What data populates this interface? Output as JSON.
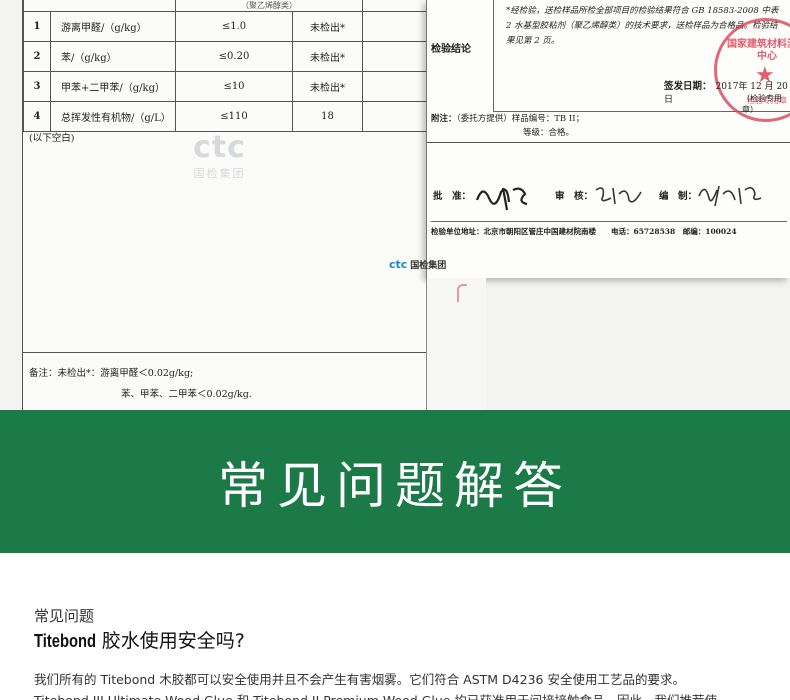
{
  "report": {
    "header_partial": "（聚乙烯醇类）",
    "rows": [
      {
        "no": "1",
        "item": "游离甲醛/（g/kg）",
        "limit": "≤1.0",
        "result": "未检出*"
      },
      {
        "no": "2",
        "item": "苯/（g/kg）",
        "limit": "≤0.20",
        "result": "未检出*"
      },
      {
        "no": "3",
        "item": "甲苯+二甲苯/（g/kg）",
        "limit": "≤10",
        "result": "未检出*"
      },
      {
        "no": "4",
        "item": "总挥发性有机物/（g/L）",
        "limit": "≤110",
        "result": "18"
      }
    ],
    "blank_note": "(以下空白)",
    "watermark_logo": "ctc",
    "watermark_name": "国检集团",
    "remark_line1": "备注：未检出*：游离甲醛＜0.02g/kg;",
    "remark_line2": "苯、甲苯、二甲苯＜0.02g/kg.",
    "conclusion_label": "检验结论",
    "conclusion_text": "*经检验，送检样品所检全部项目的检验结果符合 GB 18583-2008 中表 2 水基型胶粘剂（聚乙烯醇类）的技术要求，送检样品为合格品。检验结果见第 2 页。",
    "sign_date_label": "签发日期：",
    "sign_date": "2017年 12 月 20 日",
    "seal_note": "（检验专用章）",
    "stamp_text": "国家建筑材料测试中心",
    "stamp_sub": "检验专用章",
    "attach_label": "附注：",
    "attach_line1": "（委托方提供）样品编号：TB II；",
    "attach_line2": "等级：合格。",
    "approve_label": "批　准：",
    "review_label": "审　核：",
    "compile_label": "编　制：",
    "address": "检验单位地址：北京市朝阳区管庄中国建材院南楼　　电话：65728538　邮编：100024",
    "footer_logo": "ctc",
    "footer_name": "国检集团"
  },
  "banner": {
    "title": "常见问题解答"
  },
  "faq": {
    "subtitle": "常见问题",
    "brand": "Titebond",
    "question": " 胶水使用安全吗?",
    "answer_line1": "我们所有的 Titebond 木胶都可以安全使用并且不会产生有害烟雾。它们符合 ASTM D4236 安全使用工艺品的要求。",
    "answer_line2": "Titebond III Ultimate Wood Glue 和 Titebond II Premium Wood Glue 均已获准用于间接接触食品，因此，我们推荐使"
  }
}
